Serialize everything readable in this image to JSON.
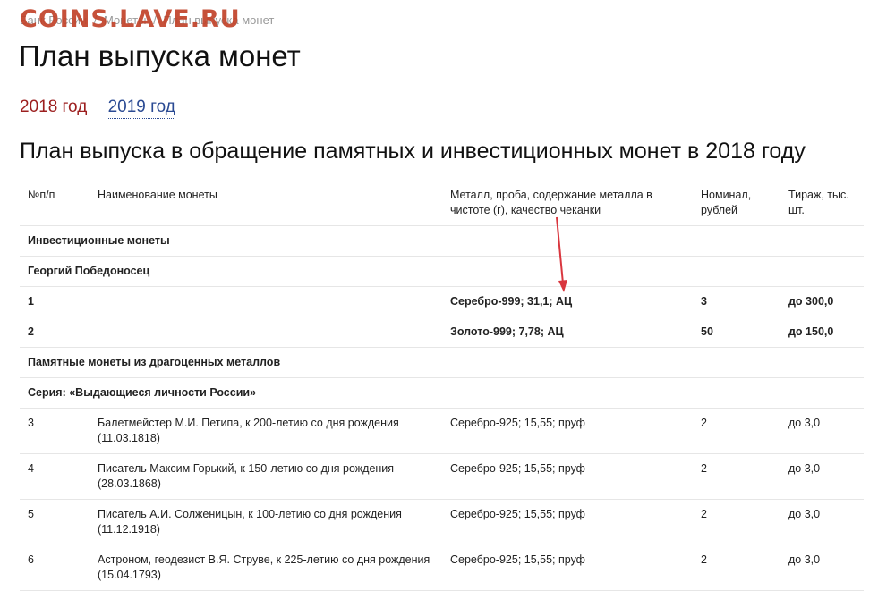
{
  "watermark": "COINS.LAVE.RU",
  "breadcrumb": [
    "Банк России",
    "Монеты",
    "План выпуска монет"
  ],
  "page_title": "План выпуска монет",
  "year_tabs": [
    {
      "label": "2018 год",
      "active": true
    },
    {
      "label": "2019 год",
      "active": false
    }
  ],
  "section_title": "План выпуска в обращение памятных и инвестиционных монет в 2018 году",
  "table": {
    "headers": {
      "num": "№п/п",
      "name": "Наименование монеты",
      "metal": "Металл, проба, содержание металла в чистоте (г), качество чеканки",
      "nominal": "Номинал, рублей",
      "mintage": "Тираж, тыс. шт."
    },
    "group_investment": "Инвестиционные монеты",
    "subgroup_george": "Георгий Победоносец",
    "invest_rows": [
      {
        "num": "1",
        "name": "",
        "metal": "Серебро-999; 31,1; АЦ",
        "nominal": "3",
        "mintage": "до 300,0"
      },
      {
        "num": "2",
        "name": "",
        "metal": "Золото-999; 7,78; АЦ",
        "nominal": "50",
        "mintage": "до 150,0"
      }
    ],
    "group_precious": "Памятные монеты из драгоценных металлов",
    "subgroup_series": "Серия: «Выдающиеся личности России»",
    "series_rows": [
      {
        "num": "3",
        "name": "Балетмейстер М.И. Петипа, к 200-летию со дня рождения (11.03.1818)",
        "metal": "Серебро-925; 15,55; пруф",
        "nominal": "2",
        "mintage": "до 3,0"
      },
      {
        "num": "4",
        "name": "Писатель Максим Горький, к 150-летию со дня рождения (28.03.1868)",
        "metal": "Серебро-925; 15,55; пруф",
        "nominal": "2",
        "mintage": "до 3,0"
      },
      {
        "num": "5",
        "name": "Писатель А.И. Солженицын, к 100-летию со дня рождения (11.12.1918)",
        "metal": "Серебро-925; 15,55; пруф",
        "nominal": "2",
        "mintage": "до 3,0"
      },
      {
        "num": "6",
        "name": "Астроном, геодезист В.Я. Струве, к 225-летию со дня рождения (15.04.1793)",
        "metal": "Серебро-925; 15,55; пруф",
        "nominal": "2",
        "mintage": "до 3,0"
      }
    ]
  },
  "colors": {
    "watermark": "#c2432a",
    "active_year": "#9c1f1f",
    "link_year": "#2a4a93",
    "arrow": "#d9363e"
  }
}
